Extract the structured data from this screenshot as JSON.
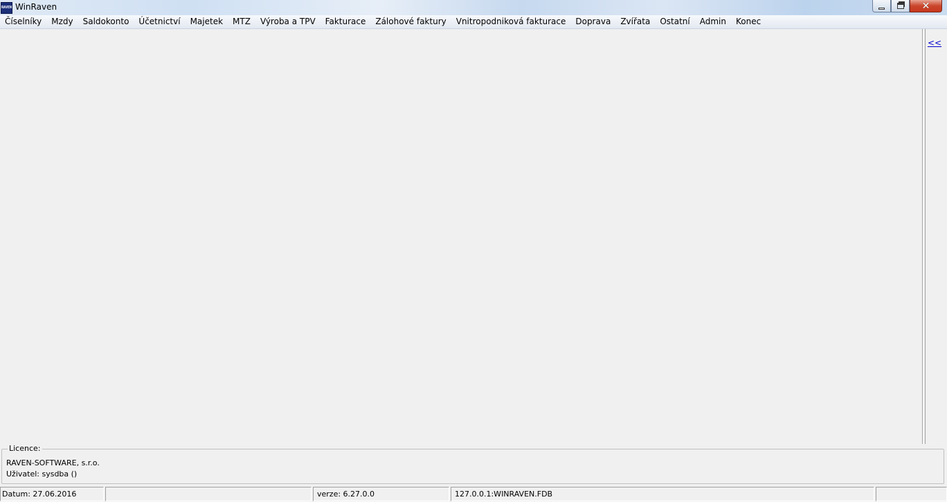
{
  "window": {
    "title": "WinRaven",
    "icon_text": "RAVEN",
    "close_glyph": "✕"
  },
  "menu": {
    "items": [
      {
        "label": "Číselníky"
      },
      {
        "label": "Mzdy"
      },
      {
        "label": "Saldokonto"
      },
      {
        "label": "Účetnictví"
      },
      {
        "label": "Majetek"
      },
      {
        "label": "MTZ"
      },
      {
        "label": "Výroba a TPV"
      },
      {
        "label": "Fakturace"
      },
      {
        "label": "Zálohové faktury"
      },
      {
        "label": "Vnitropodniková fakturace"
      },
      {
        "label": "Doprava"
      },
      {
        "label": "Zvířata"
      },
      {
        "label": "Ostatní"
      },
      {
        "label": "Admin"
      },
      {
        "label": "Konec"
      }
    ]
  },
  "side_panel": {
    "collapse_label": "<<"
  },
  "licence": {
    "legend": "Licence:",
    "company": "RAVEN-SOFTWARE, s.r.o.",
    "user": "Uživatel: sysdba ()"
  },
  "status": {
    "date": "Datum: 27.06.2016",
    "panel2": "",
    "version": "verze: 6.27.0.0",
    "database": "127.0.0.1:WINRAVEN.FDB",
    "panel5": ""
  },
  "colors": {
    "link": "#0000cc",
    "close_button": "#c7391f",
    "background": "#f0f0f0"
  }
}
